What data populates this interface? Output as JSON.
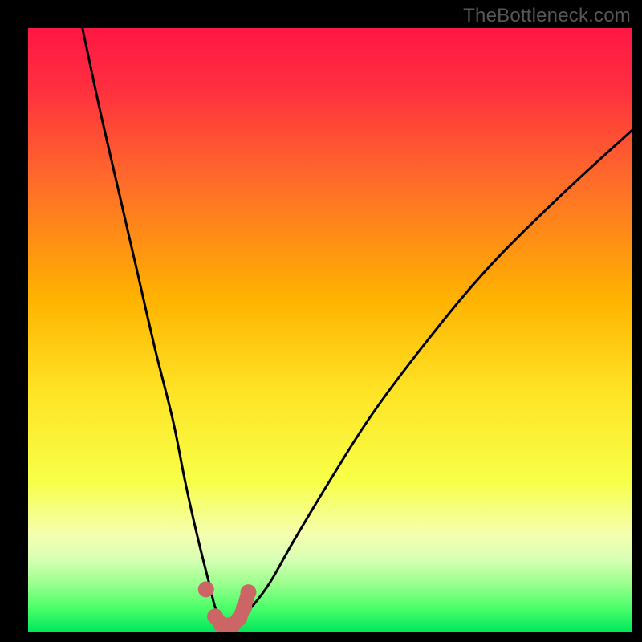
{
  "watermark": "TheBottleneck.com",
  "chart_data": {
    "type": "line",
    "title": "",
    "xlabel": "",
    "ylabel": "",
    "xlim": [
      0,
      100
    ],
    "ylim": [
      0,
      100
    ],
    "grid": false,
    "legend": false,
    "series": [
      {
        "name": "bottleneck-curve",
        "x": [
          9,
          12,
          15,
          18,
          21,
          24,
          26,
          28,
          30,
          31,
          32,
          33,
          34,
          35,
          37,
          40,
          44,
          50,
          57,
          66,
          76,
          88,
          100
        ],
        "y": [
          100,
          86,
          73,
          60,
          47,
          35,
          25,
          16,
          8,
          4,
          2,
          1,
          1,
          2,
          4,
          8,
          15,
          25,
          36,
          48,
          60,
          72,
          83
        ]
      }
    ],
    "markers": {
      "name": "highlighted-points",
      "color": "#cc6666",
      "x": [
        29.5,
        31,
        32,
        33,
        34,
        35,
        35.8,
        36.5
      ],
      "y": [
        7,
        2.5,
        1.2,
        1,
        1.2,
        2.2,
        4,
        6.5
      ]
    },
    "gradient_stops": [
      {
        "pct": 0,
        "color": "#ff1744"
      },
      {
        "pct": 10,
        "color": "#ff2f3f"
      },
      {
        "pct": 25,
        "color": "#ff6a2a"
      },
      {
        "pct": 45,
        "color": "#ffb300"
      },
      {
        "pct": 60,
        "color": "#ffe325"
      },
      {
        "pct": 75,
        "color": "#f7ff47"
      },
      {
        "pct": 84,
        "color": "#f4ffb0"
      },
      {
        "pct": 88,
        "color": "#d8ffb4"
      },
      {
        "pct": 92,
        "color": "#9bff8e"
      },
      {
        "pct": 96,
        "color": "#4dff6a"
      },
      {
        "pct": 100,
        "color": "#00e85c"
      }
    ]
  }
}
